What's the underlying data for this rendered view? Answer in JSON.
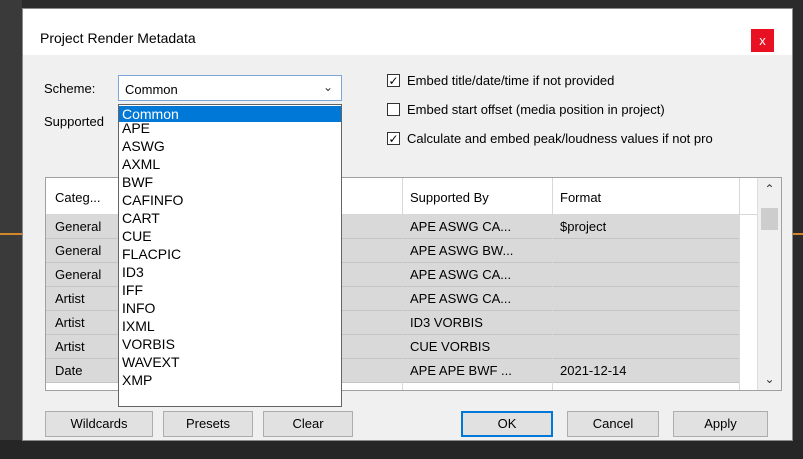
{
  "dialog": {
    "title": "Project Render Metadata",
    "close_glyph": "x"
  },
  "scheme": {
    "label": "Scheme:",
    "selected": "Common",
    "options": [
      "Common",
      "APE",
      "ASWG",
      "AXML",
      "BWF",
      "CAFINFO",
      "CART",
      "CUE",
      "FLACPIC",
      "ID3",
      "IFF",
      "INFO",
      "IXML",
      "VORBIS",
      "WAVEXT",
      "XMP"
    ]
  },
  "supported_label": "Supported",
  "checkboxes": [
    {
      "label": "Embed title/date/time if not provided",
      "checked": true
    },
    {
      "label": "Embed start offset (media position in project)",
      "checked": false
    },
    {
      "label": "Calculate and embed peak/loudness values if not pro",
      "checked": true
    }
  ],
  "table": {
    "columns": [
      "Categ...",
      "",
      "Supported By",
      "Format"
    ],
    "rows": [
      {
        "category": "General",
        "supported_by": "APE ASWG CA...",
        "format": "$project"
      },
      {
        "category": "General",
        "supported_by": "APE ASWG BW...",
        "format": ""
      },
      {
        "category": "General",
        "supported_by": "APE ASWG CA...",
        "format": ""
      },
      {
        "category": "Artist",
        "supported_by": "APE ASWG CA...",
        "format": ""
      },
      {
        "category": "Artist",
        "supported_by": "ID3 VORBIS",
        "format": ""
      },
      {
        "category": "Artist",
        "supported_by": "CUE VORBIS",
        "format": ""
      },
      {
        "category": "Date",
        "supported_by": "APE APE BWF ...",
        "format": "2021-12-14"
      }
    ]
  },
  "buttons": {
    "wildcards": "Wildcards",
    "presets": "Presets",
    "clear": "Clear",
    "ok": "OK",
    "cancel": "Cancel",
    "apply": "Apply"
  },
  "colors": {
    "accent": "#0078d7",
    "close": "#e81123"
  }
}
